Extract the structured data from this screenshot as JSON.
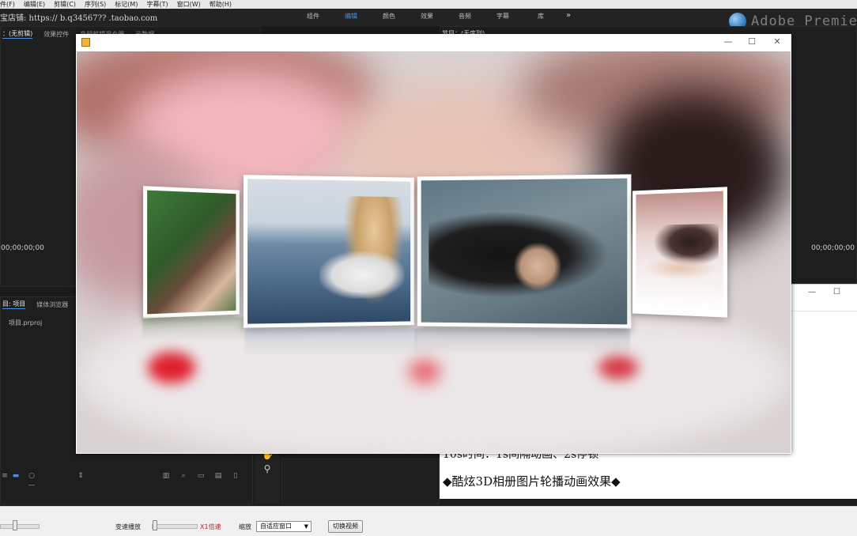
{
  "menubar": {
    "items": [
      "件(F)",
      "编辑(E)",
      "剪辑(C)",
      "序列(S)",
      "标记(M)",
      "字幕(T)",
      "窗口(W)",
      "帮助(H)"
    ]
  },
  "appbar": {
    "shop_text": "宝店铺: https://  b.q34567?? .taobao.com",
    "workspaces": [
      "组件",
      "编辑",
      "颜色",
      "效果",
      "音频",
      "字幕",
      "库"
    ],
    "active_workspace": "编辑",
    "more": "»",
    "brand": "Adobe Premier"
  },
  "panels": {
    "source_tabs": [
      "：(无剪辑)",
      "效果控件",
      "音频剪辑混合器",
      "元数据"
    ],
    "program_tab": "节目：(无序列)",
    "left_timecode": "00;00;00;00",
    "right_timecode": "00;00;00;00",
    "project_tabs": [
      "目: 项目",
      "媒体浏览器"
    ],
    "project_file": "项目.prproj"
  },
  "preview_window": {
    "controls": {
      "minimize": "—",
      "maximize": "☐",
      "close": "✕"
    },
    "colors": {
      "background": "#d9d2d2",
      "petal": "#e0202e"
    }
  },
  "note_window": {
    "line1": "10s时间：1s间隔动画、2s停顿",
    "line2": "◆酷炫3D相册图片轮播动画效果◆",
    "controls": {
      "minimize": "—",
      "maximize": "☐"
    }
  },
  "player_bar": {
    "speed_label": "变速播放",
    "speed_value": "X1倍速",
    "zoom_label": "缩放",
    "zoom_option": "自适应窗口",
    "switch_button": "切换视频"
  }
}
